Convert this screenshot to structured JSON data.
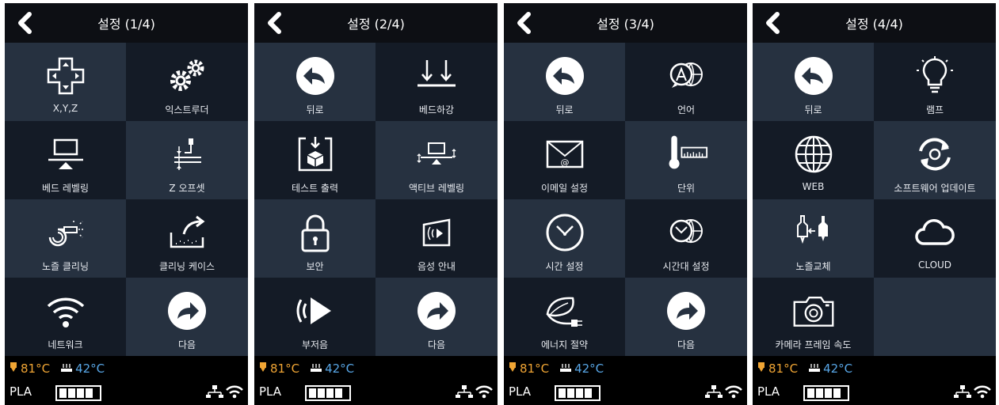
{
  "colors": {
    "tile_light": "#263140",
    "tile_dark": "#141b26",
    "nozzle": "#f0a534",
    "bed": "#58a6e6",
    "background": "#0d0f14"
  },
  "screens": [
    {
      "title": "설정 (1/4)",
      "tiles": [
        {
          "label": "X,Y,Z",
          "icon": "dpad-icon"
        },
        {
          "label": "익스트루더",
          "icon": "gears-icon"
        },
        {
          "label": "베드 레벨링",
          "icon": "bed-level-icon"
        },
        {
          "label": "Z 오프셋",
          "icon": "z-offset-icon"
        },
        {
          "label": "노즐 클리닝",
          "icon": "nozzle-clean-icon"
        },
        {
          "label": "클리닝 케이스",
          "icon": "cleaning-case-icon"
        },
        {
          "label": "네트워크",
          "icon": "wifi-icon"
        },
        {
          "label": "다음",
          "icon": "next-icon"
        }
      ],
      "status": {
        "nozzle": "81°C",
        "bed": "42°C",
        "filament": "PLA"
      }
    },
    {
      "title": "설정 (2/4)",
      "tiles": [
        {
          "label": "뒤로",
          "icon": "back-circle-icon"
        },
        {
          "label": "베드하강",
          "icon": "bed-down-icon"
        },
        {
          "label": "테스트 출력",
          "icon": "test-print-icon"
        },
        {
          "label": "액티브 레벨링",
          "icon": "active-level-icon"
        },
        {
          "label": "보안",
          "icon": "lock-icon"
        },
        {
          "label": "음성 안내",
          "icon": "voice-guide-icon"
        },
        {
          "label": "부저음",
          "icon": "buzzer-icon"
        },
        {
          "label": "다음",
          "icon": "next-icon"
        }
      ],
      "status": {
        "nozzle": "81°C",
        "bed": "42°C",
        "filament": "PLA"
      }
    },
    {
      "title": "설정 (3/4)",
      "tiles": [
        {
          "label": "뒤로",
          "icon": "back-circle-icon"
        },
        {
          "label": "언어",
          "icon": "language-icon"
        },
        {
          "label": "이메일 설정",
          "icon": "email-icon"
        },
        {
          "label": "단위",
          "icon": "thermometer-icon"
        },
        {
          "label": "시간 설정",
          "icon": "clock-icon"
        },
        {
          "label": "시간대 설정",
          "icon": "timezone-icon"
        },
        {
          "label": "에너지 절약",
          "icon": "energy-icon"
        },
        {
          "label": "다음",
          "icon": "next-icon"
        }
      ],
      "status": {
        "nozzle": "81°C",
        "bed": "42°C",
        "filament": "PLA"
      }
    },
    {
      "title": "설정 (4/4)",
      "tiles": [
        {
          "label": "뒤로",
          "icon": "back-circle-icon"
        },
        {
          "label": "램프",
          "icon": "lamp-icon"
        },
        {
          "label": "WEB",
          "icon": "globe-icon"
        },
        {
          "label": "소프트웨어 업데이트",
          "icon": "update-icon"
        },
        {
          "label": "노즐교체",
          "icon": "nozzle-change-icon"
        },
        {
          "label": "CLOUD",
          "icon": "cloud-icon"
        },
        {
          "label": "카메라 프레임 속도",
          "icon": "camera-icon"
        },
        {
          "label": "",
          "icon": ""
        }
      ],
      "status": {
        "nozzle": "81°C",
        "bed": "42°C",
        "filament": "PLA"
      }
    }
  ]
}
